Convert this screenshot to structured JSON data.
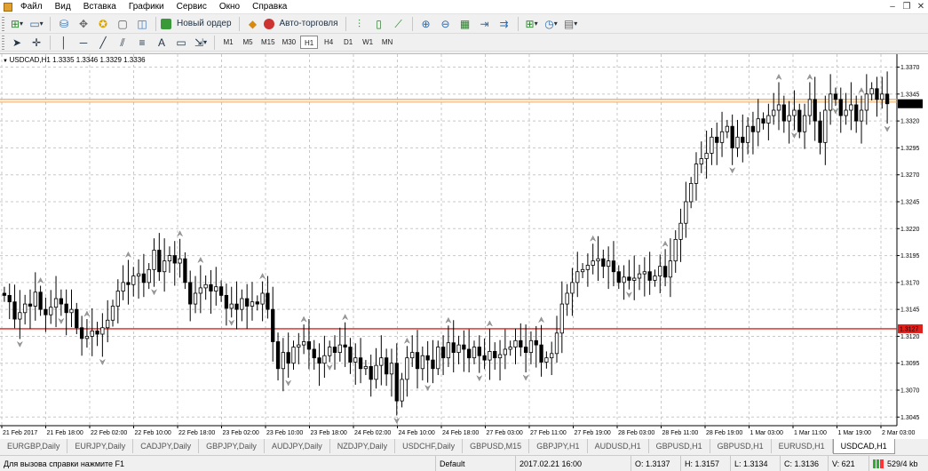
{
  "menu": {
    "items": [
      "Файл",
      "Вид",
      "Вставка",
      "Графики",
      "Сервис",
      "Окно",
      "Справка"
    ]
  },
  "window_controls": [
    "minimize",
    "restore",
    "close"
  ],
  "toolbar1": {
    "new_order_label": "Новый ордер",
    "auto_trading_label": "Авто-торговля"
  },
  "toolbar2": {
    "timeframes": [
      "M1",
      "M5",
      "M15",
      "M30",
      "H1",
      "H4",
      "D1",
      "W1",
      "MN"
    ],
    "active_timeframe": "H1"
  },
  "chart": {
    "symbol_label": "USDCAD,H1  1.3335 1.3346 1.3329 1.3336",
    "colors": {
      "background": "#ffffff",
      "grid": "#c8c8c8",
      "bull": "#ffffff",
      "bear": "#000000",
      "support_line": "#e0201c",
      "ask_line": "#e8a860",
      "fractal": "#999999"
    }
  },
  "chart_data": {
    "type": "candlestick",
    "symbol": "USDCAD",
    "timeframe": "H1",
    "ylim": [
      1.3037,
      1.3382
    ],
    "y_ticks": [
      "1.3370",
      "1.3345",
      "1.3320",
      "1.3295",
      "1.3270",
      "1.3245",
      "1.3220",
      "1.3195",
      "1.3170",
      "1.3145",
      "1.3120",
      "1.3095",
      "1.3070",
      "1.3045"
    ],
    "x_ticks": [
      "21 Feb 2017",
      "21 Feb 18:00",
      "22 Feb 02:00",
      "22 Feb 10:00",
      "22 Feb 18:00",
      "23 Feb 02:00",
      "23 Feb 10:00",
      "23 Feb 18:00",
      "24 Feb 02:00",
      "24 Feb 10:00",
      "24 Feb 18:00",
      "27 Feb 03:00",
      "27 Feb 11:00",
      "27 Feb 19:00",
      "28 Feb 03:00",
      "28 Feb 11:00",
      "28 Feb 19:00",
      "1 Mar 03:00",
      "1 Mar 11:00",
      "1 Mar 19:00",
      "2 Mar 03:00"
    ],
    "price_labels": [
      {
        "value": "1.3336",
        "role": "bid"
      },
      {
        "value": "1.3127",
        "role": "horizontal-line"
      }
    ],
    "horizontal_lines": [
      {
        "value": 1.3127,
        "color": "#e0201c"
      },
      {
        "value": 1.334,
        "color": "#e8a860"
      }
    ],
    "closes": [
      1.3158,
      1.3152,
      1.3136,
      1.3142,
      1.315,
      1.3148,
      1.3161,
      1.3145,
      1.314,
      1.3147,
      1.3155,
      1.315,
      1.3142,
      1.3145,
      1.3128,
      1.3118,
      1.312,
      1.3125,
      1.3122,
      1.3128,
      1.3135,
      1.3148,
      1.3162,
      1.317,
      1.3168,
      1.3176,
      1.3178,
      1.317,
      1.3182,
      1.32,
      1.318,
      1.319,
      1.3195,
      1.3188,
      1.3192,
      1.317,
      1.315,
      1.316,
      1.3165,
      1.3168,
      1.3162,
      1.3166,
      1.3158,
      1.3146,
      1.315,
      1.3145,
      1.3155,
      1.3148,
      1.3152,
      1.315,
      1.316,
      1.3145,
      1.3115,
      1.309,
      1.3105,
      1.3095,
      1.311,
      1.3112,
      1.3115,
      1.3108,
      1.31,
      1.3095,
      1.3102,
      1.311,
      1.3105,
      1.3112,
      1.311,
      1.3096,
      1.31,
      1.309,
      1.3092,
      1.308,
      1.3093,
      1.31,
      1.3085,
      1.3095,
      1.306,
      1.308,
      1.31,
      1.3105,
      1.309,
      1.3102,
      1.3098,
      1.309,
      1.311,
      1.31,
      1.3114,
      1.3105,
      1.3112,
      1.3108,
      1.31,
      1.311,
      1.3102,
      1.3098,
      1.3106,
      1.31,
      1.3103,
      1.3108,
      1.311,
      1.3116,
      1.311,
      1.3105,
      1.3116,
      1.3112,
      1.3096,
      1.31,
      1.3104,
      1.3123,
      1.315,
      1.316,
      1.317,
      1.318,
      1.3182,
      1.3186,
      1.319,
      1.3192,
      1.3185,
      1.319,
      1.318,
      1.317,
      1.3175,
      1.3172,
      1.3174,
      1.3178,
      1.318,
      1.3172,
      1.3176,
      1.3185,
      1.3175,
      1.319,
      1.321,
      1.3225,
      1.3245,
      1.3262,
      1.328,
      1.3285,
      1.329,
      1.3305,
      1.33,
      1.331,
      1.3315,
      1.3295,
      1.3305,
      1.33,
      1.3315,
      1.331,
      1.3322,
      1.3318,
      1.3325,
      1.333,
      1.3335,
      1.332,
      1.3325,
      1.333,
      1.331,
      1.3325,
      1.334,
      1.332,
      1.33,
      1.333,
      1.3345,
      1.334,
      1.3325,
      1.333,
      1.3335,
      1.332,
      1.333,
      1.3345,
      1.335,
      1.334,
      1.3345,
      1.3336
    ],
    "first_open": 1.316,
    "fractals_up_at": [
      7,
      16,
      24,
      34,
      38,
      50,
      58,
      66,
      78,
      86,
      94,
      104,
      114,
      128,
      150,
      156,
      166,
      176
    ],
    "fractals_down_at": [
      3,
      11,
      19,
      29,
      44,
      55,
      63,
      76,
      82,
      92,
      101,
      121,
      141,
      153,
      161,
      171
    ]
  },
  "tabs": {
    "items": [
      "EURGBP,Daily",
      "EURJPY,Daily",
      "CADJPY,Daily",
      "GBPJPY,Daily",
      "AUDJPY,Daily",
      "NZDJPY,Daily",
      "USDCHF,Daily",
      "GBPUSD,M15",
      "GBPJPY,H1",
      "AUDUSD,H1",
      "GBPUSD,H1",
      "GBPUSD,H1",
      "EURUSD,H1",
      "USDCAD,H1"
    ],
    "active": "USDCAD,H1"
  },
  "status": {
    "help": "Для вызова справки нажмите F1",
    "profile": "Default",
    "datetime": "2017.02.21 16:00",
    "open": "O: 1.3137",
    "high": "H: 1.3157",
    "low": "L: 1.3134",
    "close": "C: 1.3136",
    "volume": "V: 621",
    "traffic": "529/4 kb"
  }
}
